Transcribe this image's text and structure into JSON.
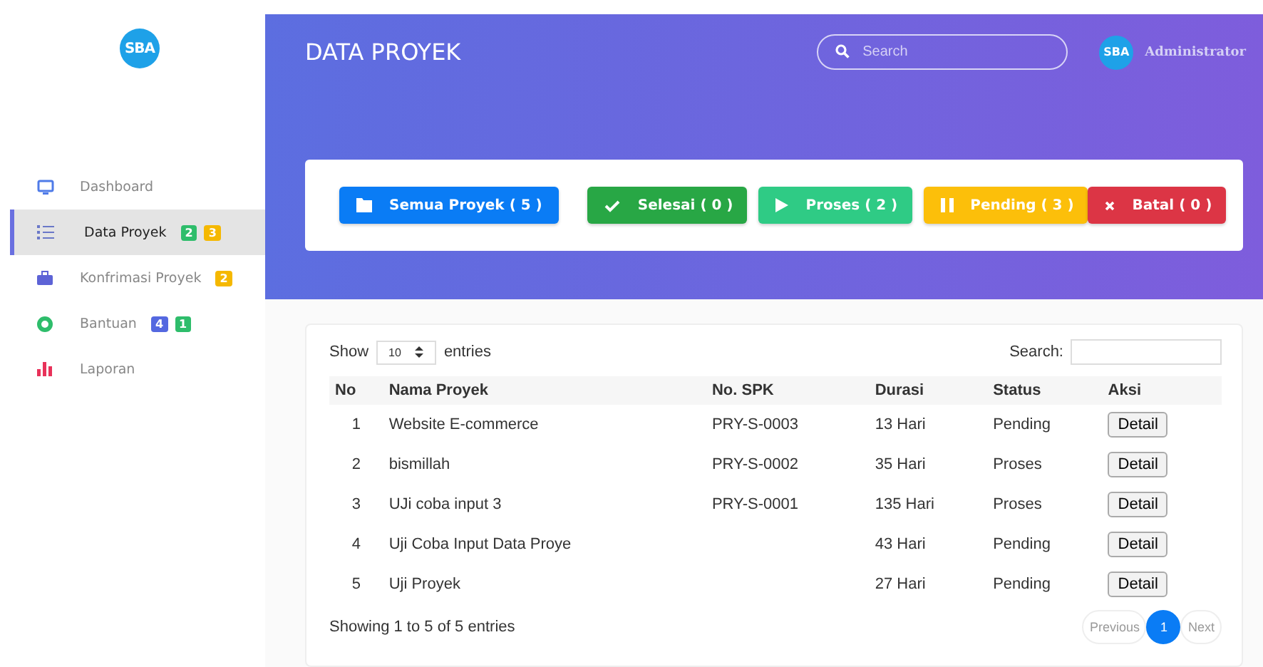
{
  "logo": "SBA",
  "sidebar": {
    "items": [
      {
        "label": "Dashboard",
        "kind": "monitor",
        "selected": false
      },
      {
        "label": "Data Proyek",
        "kind": "list",
        "selected": true,
        "badges": [
          {
            "text": "2",
            "color": "#2ebd6b"
          },
          {
            "text": "3",
            "color": "#f5b800"
          }
        ]
      },
      {
        "label": "Konfrimasi Proyek",
        "kind": "bag",
        "selected": false,
        "badges": [
          {
            "text": "2",
            "color": "#f5b800"
          }
        ]
      },
      {
        "label": "Bantuan",
        "kind": "help",
        "selected": false,
        "badges": [
          {
            "text": "4",
            "color": "#5468e0"
          },
          {
            "text": "1",
            "color": "#2ebd6b"
          }
        ]
      },
      {
        "label": "Laporan",
        "kind": "chart",
        "selected": false
      }
    ]
  },
  "header": {
    "title": "DATA PROYEK",
    "search": {
      "placeholder": "Search"
    },
    "user": {
      "avatar": "SBA",
      "name": "Administrator"
    }
  },
  "filters": [
    {
      "label": "Semua Proyek ( 5 )",
      "kind": "all",
      "color": "#0a7cf5"
    },
    {
      "label": "Selesai ( 0 )",
      "kind": "done",
      "color": "#28a745"
    },
    {
      "label": "Proses ( 2 )",
      "kind": "process",
      "color": "#2fcb85"
    },
    {
      "label": "Pending ( 3 )",
      "kind": "pending",
      "color": "#fcbf0a"
    },
    {
      "label": "Batal ( 0 )",
      "kind": "cancel",
      "color": "#dc3545"
    }
  ],
  "table": {
    "length_label_before": "Show",
    "length_value": "10",
    "length_label_after": "entries",
    "search_label": "Search:",
    "columns": [
      "No",
      "Nama Proyek",
      "No. SPK",
      "Durasi",
      "Status",
      "Aksi"
    ],
    "rows": [
      {
        "no": "1",
        "name": "Website E-commerce",
        "spk": "PRY-S-0003",
        "durasi": "13 Hari",
        "status": "Pending",
        "action": "Detail"
      },
      {
        "no": "2",
        "name": "bismillah",
        "spk": "PRY-S-0002",
        "durasi": "35 Hari",
        "status": "Proses",
        "action": "Detail"
      },
      {
        "no": "3",
        "name": "UJi coba input 3",
        "spk": "PRY-S-0001",
        "durasi": "135 Hari",
        "status": "Proses",
        "action": "Detail"
      },
      {
        "no": "4",
        "name": "Uji Coba Input Data Proye",
        "durasi": "43 Hari",
        "status": "Pending",
        "action": "Detail"
      },
      {
        "no": "5",
        "name": "Uji Proyek",
        "durasi": "27 Hari",
        "status": "Pending",
        "action": "Detail"
      }
    ],
    "info": "Showing 1 to 5 of 5 entries",
    "pagination": [
      {
        "label": "Previous",
        "kind": "prev",
        "selected": false
      },
      {
        "label": "1",
        "kind": "page",
        "selected": true
      },
      {
        "label": "Next",
        "kind": "next",
        "selected": false
      }
    ]
  }
}
